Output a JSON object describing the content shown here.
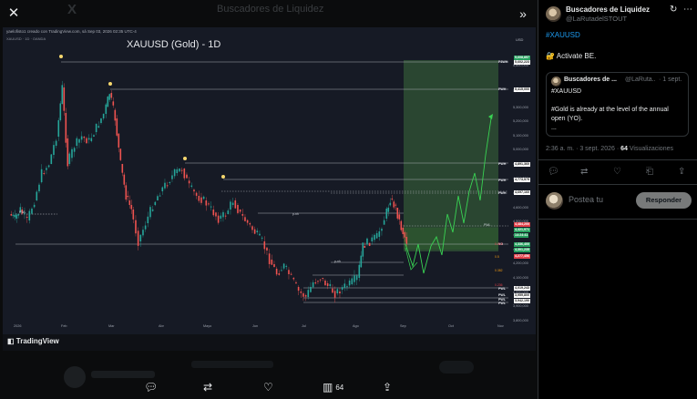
{
  "viewer": {
    "close_icon": "close-icon",
    "collapse_icon": "chevron-double-right-icon",
    "background_title": "Buscadores de Liquidez"
  },
  "chart_image": {
    "snapshot_text": "yaelofisto1 creado con TradingView.com, sá Sep 03, 2026 02:35 UTC-4",
    "symbol_line": "XAUUSD · 1D · OANDA",
    "title": "XAUUSD (Gold) - 1D",
    "currency": "USD",
    "price_labels": [
      "5,600,000",
      "5,400,000",
      "5,300,000",
      "5,200,000",
      "5,100,000",
      "5,000,000",
      "4,900,000",
      "4,800,000",
      "4,700,000",
      "4,600,000",
      "4,500,000",
      "4,400,000",
      "4,300,000",
      "4,200,000",
      "4,100,000",
      "4,000,000",
      "3,900,000",
      "3,800,000"
    ],
    "right_tags": [
      {
        "text": "5,608,857",
        "style": "g"
      },
      {
        "text": "5,602,223",
        "style": "w"
      },
      {
        "text": "5,415,000",
        "style": "w"
      },
      {
        "text": "4,891,360",
        "style": "w"
      },
      {
        "text": "4,773,575",
        "style": "w"
      },
      {
        "text": "4,697,160",
        "style": "w"
      },
      {
        "text": "4,484,200",
        "style": "r"
      },
      {
        "text": "4,421,971",
        "style": "g"
      },
      {
        "text": "14:24:41",
        "style": "g"
      },
      {
        "text": "4,336,400",
        "style": "g"
      },
      {
        "text": "4,301,235",
        "style": "g"
      },
      {
        "text": "4,277,456",
        "style": "r"
      },
      {
        "text": "4,019,243",
        "style": "w"
      },
      {
        "text": "3,959,800",
        "style": "w"
      },
      {
        "text": "3,942,190",
        "style": "w"
      }
    ],
    "side_labels": [
      "P3WH",
      "PWH",
      "PWH",
      "PWH",
      "PWH",
      "YO",
      "PWL",
      "PWL",
      "PWL",
      "PWL"
    ],
    "level_labels": [
      "PWL",
      "p-nh",
      "p-nh",
      "PWL"
    ],
    "fib_labels": [
      "0.618",
      "0.5",
      "0.382",
      "0.236"
    ],
    "months": [
      "2026",
      "Feb",
      "Mar",
      "Abr",
      "Mayo",
      "Jun",
      "Jul",
      "Ago",
      "Sep",
      "Oct",
      "Nov"
    ],
    "watermark": "TradingView"
  },
  "bottom_bar": {
    "reply_icon": "reply-icon",
    "retweet_icon": "retweet-icon",
    "like_icon": "heart-icon",
    "views_icon": "views-icon",
    "views_count": "64",
    "share_icon": "share-icon"
  },
  "tweet": {
    "author_name": "Buscadores de Liquidez",
    "author_handle": "@LaRutadelSTOUT",
    "hashtag": "#XAUUSD",
    "body": "🔐 Activate BE.",
    "quote": {
      "name": "Buscadores de ...",
      "handle": "@LaRuta...",
      "date": "· 1 sept.",
      "line1": "#XAUUSD",
      "line2": "#Gold is already at the level of the annual",
      "line3": "open (YO).",
      "line4": "..."
    },
    "time_date": "2:36 a. m. · 3 sept. 2026 ·",
    "views_count": "64",
    "views_label": "Visualizaciones",
    "reply_placeholder": "Postea tu",
    "reply_button": "Responder"
  },
  "colors": {
    "bull": "#26a69a",
    "bear": "#ef5350",
    "projection": "#39d353",
    "target_box": "#3d6b3d",
    "link": "#1d9bf0"
  }
}
